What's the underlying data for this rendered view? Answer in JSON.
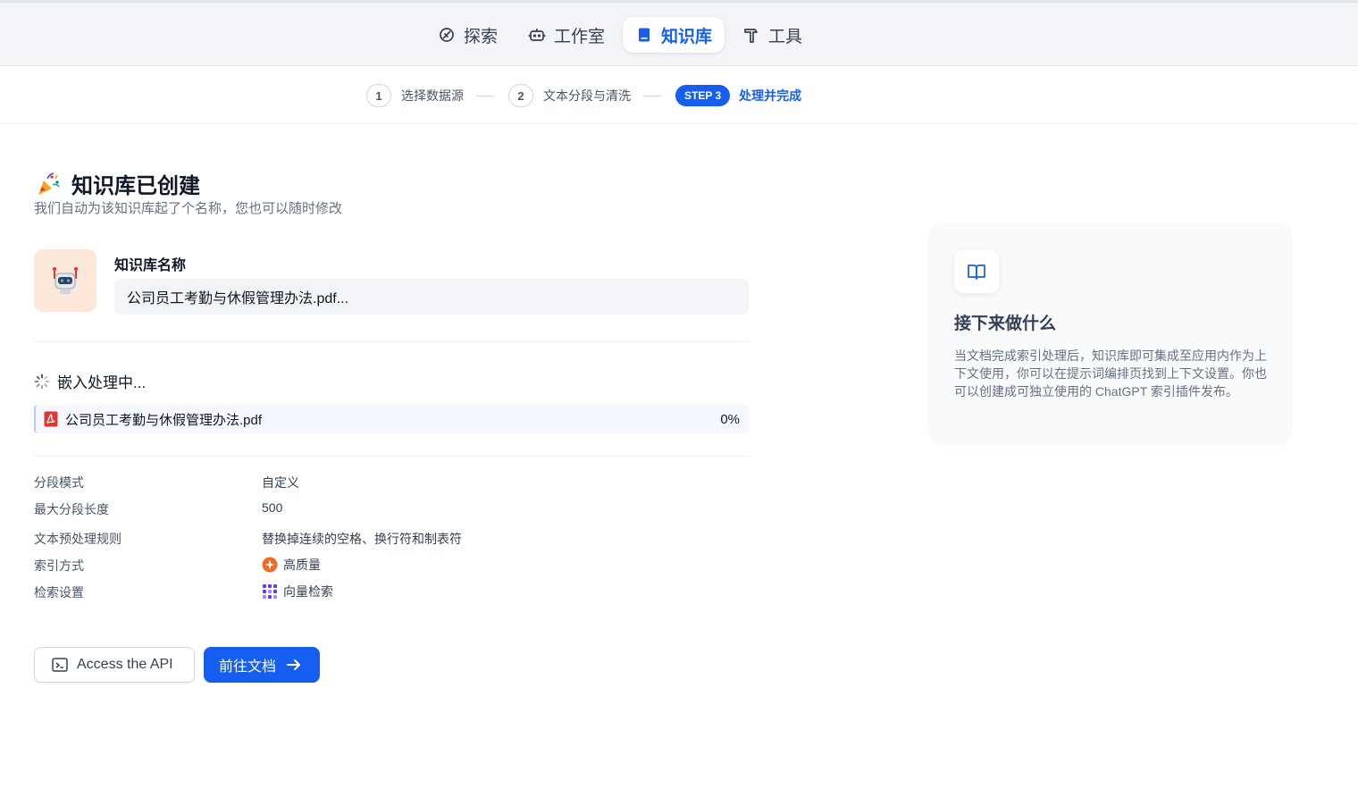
{
  "nav": {
    "items": [
      {
        "label": "探索",
        "icon": "compass-icon"
      },
      {
        "label": "工作室",
        "icon": "robot-icon"
      },
      {
        "label": "知识库",
        "icon": "book-icon",
        "active": true
      },
      {
        "label": "工具",
        "icon": "hammer-icon"
      }
    ]
  },
  "stepper": {
    "steps": [
      {
        "number": "1",
        "label": "选择数据源"
      },
      {
        "number": "2",
        "label": "文本分段与清洗"
      },
      {
        "badge": "STEP 3",
        "label": "处理并完成"
      }
    ]
  },
  "main": {
    "title": "知识库已创建",
    "subtitle": "我们自动为该知识库起了个名称，您也可以随时修改",
    "name_label": "知识库名称",
    "name_value": "公司员工考勤与休假管理办法.pdf...",
    "embedding": {
      "status": "嵌入处理中...",
      "file_name": "公司员工考勤与休假管理办法.pdf",
      "progress_text": "0%",
      "progress": 0
    },
    "meta": [
      {
        "label": "分段模式",
        "value": "自定义"
      },
      {
        "label": "最大分段长度",
        "value": "500"
      },
      {
        "label": "文本预处理规则",
        "value": "替换掉连续的空格、换行符和制表符"
      },
      {
        "label": "索引方式",
        "value": "高质量",
        "icon": "high-quality-icon"
      },
      {
        "label": "检索设置",
        "value": "向量检索",
        "icon": "vector-grid-icon"
      }
    ],
    "buttons": {
      "api": "Access the API",
      "docs": "前往文档"
    }
  },
  "panel": {
    "title": "接下来做什么",
    "text": "当文档完成索引处理后，知识库即可集成至应用内作为上下文使用，你可以在提示词编排页找到上下文设置。你也可以创建成可独立使用的 ChatGPT 索引插件发布。"
  },
  "colors": {
    "accent": "#155eef",
    "avatar_bg": "#fde7d8",
    "pdf_red": "#e2362f",
    "quality_orange": "#f06a27",
    "vector_purple": "#6938ef"
  }
}
